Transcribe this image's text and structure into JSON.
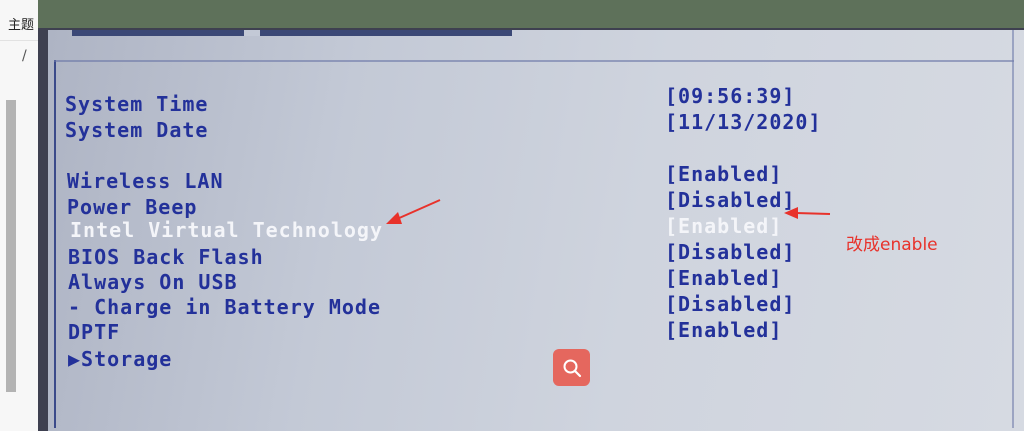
{
  "left_panel": {
    "topic_label": "主题",
    "glyph": "/"
  },
  "bios": {
    "items": [
      {
        "label": "System Time",
        "value": "[09:56:39]"
      },
      {
        "label": "System Date",
        "value": "[11/13/2020]"
      },
      {
        "label": "Wireless LAN",
        "value": "[Enabled]"
      },
      {
        "label": "Power Beep",
        "value": "[Disabled]"
      },
      {
        "label": "Intel Virtual Technology",
        "value": "[Enabled]"
      },
      {
        "label": "BIOS Back Flash",
        "value": "[Disabled]"
      },
      {
        "label": "Always On USB",
        "value": "[Enabled]"
      },
      {
        "label": "- Charge in Battery Mode",
        "value": "[Disabled]"
      },
      {
        "label": "DPTF",
        "value": "[Enabled]"
      }
    ],
    "submenu": {
      "arrow": "▶",
      "label": "Storage"
    },
    "highlighted_item": "Intel Virtual Technology"
  },
  "annotation": {
    "text": "改成enable",
    "color": "#e8322b"
  },
  "search_button": {
    "icon": "search-icon"
  }
}
